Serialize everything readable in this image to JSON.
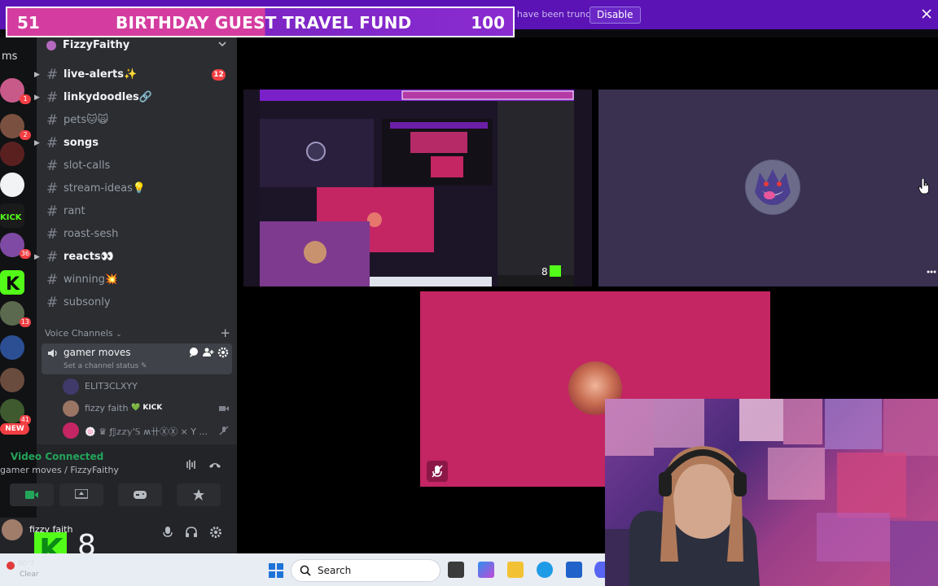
{
  "top_banner": {
    "message": "Streamer Mode is enabled. Usernames have been truncated.",
    "disable_label": "Disable"
  },
  "goal_overlay": {
    "current": "51",
    "title": "BIRTHDAY GUEST TRAVEL FUND",
    "target": "100"
  },
  "rail": {
    "label": "ms",
    "servers": [
      {
        "badge": "1"
      },
      {
        "badge": "2"
      },
      {
        "badge": ""
      },
      {
        "badge": ""
      },
      {
        "badge": ""
      },
      {
        "badge": "36"
      },
      {
        "badge": ""
      },
      {
        "badge": "13"
      },
      {
        "badge": ""
      },
      {
        "badge": ""
      },
      {
        "badge": "41"
      }
    ],
    "new_label": "NEW"
  },
  "sidebar": {
    "server_name": "FizzyFaithy",
    "channels": [
      {
        "label": "live-alerts✨",
        "unread": true,
        "badge": "12"
      },
      {
        "label": "linkydoodles🔗",
        "unread": true,
        "badge": ""
      },
      {
        "label": "pets🐱🙀",
        "unread": false,
        "badge": ""
      },
      {
        "label": "songs",
        "unread": true,
        "badge": ""
      },
      {
        "label": "slot-calls",
        "unread": false,
        "badge": ""
      },
      {
        "label": "stream-ideas💡",
        "unread": false,
        "badge": ""
      },
      {
        "label": "rant",
        "unread": false,
        "badge": ""
      },
      {
        "label": "roast-sesh",
        "unread": false,
        "badge": ""
      },
      {
        "label": "reacts👀",
        "unread": true,
        "badge": ""
      },
      {
        "label": "winning💥",
        "unread": false,
        "badge": ""
      },
      {
        "label": "subsonly",
        "unread": false,
        "badge": ""
      }
    ],
    "voice_header": "Voice Channels",
    "voice_channel": {
      "name": "gamer moves",
      "status": "Set a channel status ✎"
    },
    "members": [
      {
        "name": "ELIT3CLXYY",
        "tag": ""
      },
      {
        "name": "fizzy faith",
        "tag": "💚 KICK"
      },
      {
        "name": "🍥 ♛ ƒ𝕁𝕫𝕫𝕪'𝕊 ʍ卄ⓍⓍ × Y ...",
        "tag": ""
      }
    ]
  },
  "voice_panel": {
    "status": "Video Connected",
    "subtitle": "gamer moves / FizzyFaithy"
  },
  "user_panel": {
    "name": "fizzy faith",
    "overlay_number": "8"
  },
  "weather": {
    "temp": "60°F",
    "condition": "Clear"
  },
  "taskbar": {
    "search_placeholder": "Search"
  },
  "colors": {
    "banner": "#5b13b5",
    "goal_pink": "#d43d9f",
    "goal_purple": "#8a2bd0",
    "connected_green": "#23a55a",
    "kick_green": "#53fc18",
    "pink_tile": "#c42563",
    "notification_red": "#f23f43"
  }
}
